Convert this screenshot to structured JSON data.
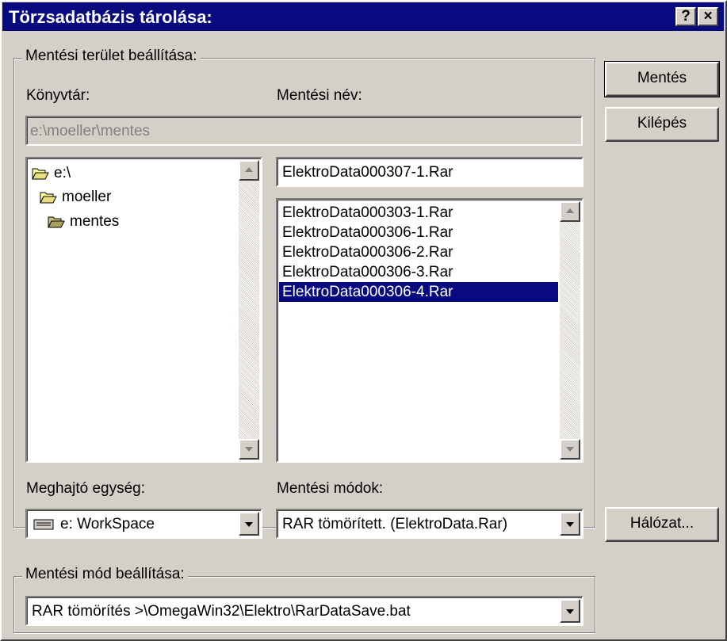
{
  "window": {
    "title": "Törzsadatbázis tárolása:",
    "help_label": "?",
    "close_label": "×"
  },
  "save_area": {
    "legend": "Mentési terület beállítása:",
    "directory_label": "Könyvtár:",
    "directory_path": "e:\\moeller\\mentes",
    "save_name_label": "Mentési név:",
    "save_name_value": "ElektroData000307-1.Rar",
    "folders": [
      "e:\\",
      "moeller",
      "mentes"
    ],
    "files": [
      "ElektroData000303-1.Rar",
      "ElektroData000306-1.Rar",
      "ElektroData000306-2.Rar",
      "ElektroData000306-3.Rar",
      "ElektroData000306-4.Rar"
    ],
    "selected_file_index": 4,
    "drive_label": "Meghajtó egység:",
    "drive_value": "e: WorkSpace",
    "modes_label": "Mentési módok:",
    "modes_value": "RAR tömörített. (ElektroData.Rar)"
  },
  "save_mode": {
    "legend": "Mentési mód beállítása:",
    "value": "RAR tömörítés >\\OmegaWin32\\Elektro\\RarDataSave.bat"
  },
  "buttons": {
    "save": "Mentés",
    "exit": "Kilépés",
    "network": "Hálózat..."
  },
  "colors": {
    "titlebar": "#0a0a80",
    "face": "#d4d0c8",
    "selection": "#0a0a80"
  }
}
